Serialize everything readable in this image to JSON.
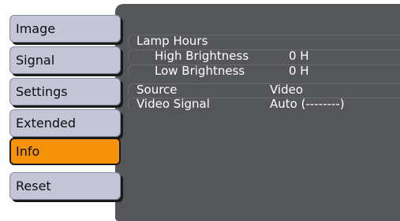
{
  "menu": {
    "items": [
      {
        "label": "Image"
      },
      {
        "label": "Signal"
      },
      {
        "label": "Settings"
      },
      {
        "label": "Extended"
      },
      {
        "label": "Info",
        "active": true
      },
      {
        "label": "Reset"
      }
    ]
  },
  "info": {
    "lamp_hours_label": "Lamp Hours",
    "high_brightness_label": "High Brightness",
    "high_brightness_value": "0 H",
    "low_brightness_label": "Low Brightness",
    "low_brightness_value": "0 H",
    "source_label": "Source",
    "source_value": "Video",
    "video_signal_label": "Video Signal",
    "video_signal_value": "Auto (--------)"
  },
  "colors": {
    "panel_bg": "#555659",
    "tab_bg": "#c5c5d8",
    "tab_active_bg": "#f6920a",
    "text_light": "#ffffff"
  }
}
